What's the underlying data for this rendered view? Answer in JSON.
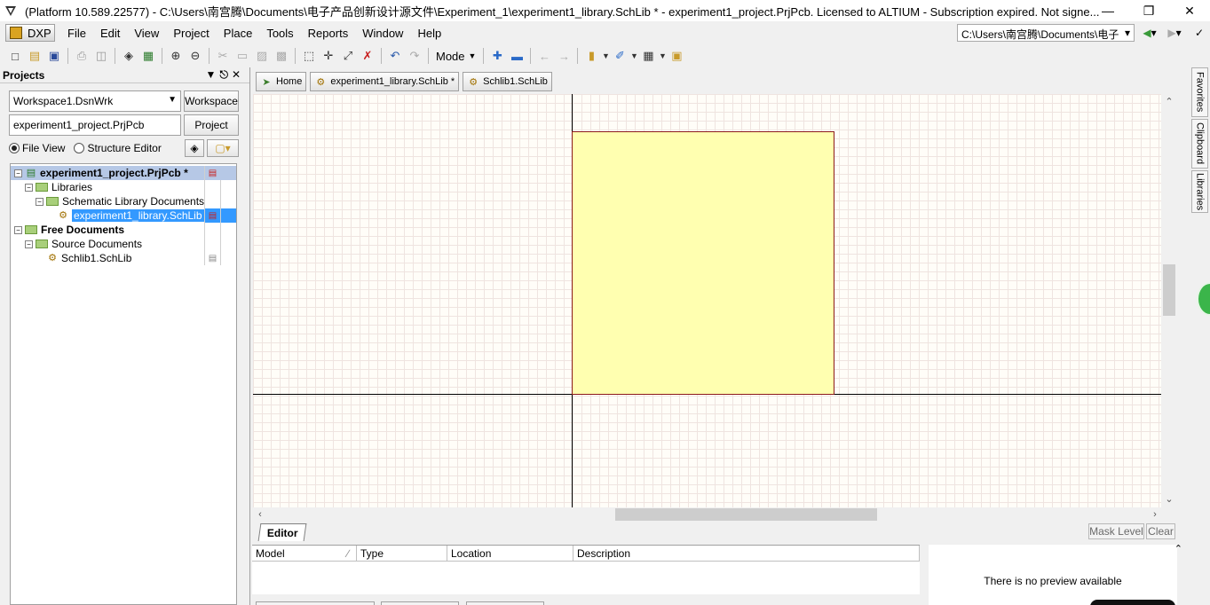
{
  "window": {
    "title": "(Platform 10.589.22577) - C:\\Users\\南宫腾\\Documents\\电子产品创新设计源文件\\Experiment_1\\experiment1_library.SchLib * - experiment1_project.PrjPcb. Licensed to ALTIUM - Subscription expired. Not signe...",
    "minimize_icon": "minimize-icon",
    "restore_icon": "restore-icon",
    "close_icon": "close-icon"
  },
  "menubar": {
    "dxp_label": "DXP",
    "items": [
      "File",
      "Edit",
      "View",
      "Project",
      "Place",
      "Tools",
      "Reports",
      "Window",
      "Help"
    ],
    "path": "C:\\Users\\南宫腾\\Documents\\电子"
  },
  "toolbar": {
    "mode_label": "Mode"
  },
  "projects_panel": {
    "title": "Projects",
    "workspace_value": "Workspace1.DsnWrk",
    "workspace_button": "Workspace",
    "project_value": "experiment1_project.PrjPcb",
    "project_button": "Project",
    "file_view_label": "File View",
    "structure_editor_label": "Structure Editor",
    "tree": [
      {
        "label": "experiment1_project.PrjPcb *",
        "level": 0,
        "type": "project",
        "bold": true
      },
      {
        "label": "Libraries",
        "level": 1,
        "type": "folder"
      },
      {
        "label": "Schematic Library Documents",
        "level": 2,
        "type": "folder"
      },
      {
        "label": "experiment1_library.SchLib *",
        "level": 3,
        "type": "schlib",
        "selected": true
      },
      {
        "label": "Free Documents",
        "level": 0,
        "type": "folder",
        "bold": true
      },
      {
        "label": "Source Documents",
        "level": 1,
        "type": "folder"
      },
      {
        "label": "Schlib1.SchLib",
        "level": 2,
        "type": "schlib"
      }
    ]
  },
  "doc_tabs": [
    {
      "label": "Home",
      "icon": "home-icon"
    },
    {
      "label": "experiment1_library.SchLib *",
      "icon": "schlib-icon"
    },
    {
      "label": "Schlib1.SchLib",
      "icon": "schlib-icon"
    }
  ],
  "side_tabs": [
    "Favorites",
    "Clipboard",
    "Libraries"
  ],
  "editor_panel": {
    "tab_label": "Editor",
    "mask_level": "Mask Level",
    "clear": "Clear",
    "columns": [
      "Model",
      "Type",
      "Location",
      "Description"
    ],
    "preview_message": "There is no preview available"
  },
  "colors": {
    "component_fill": "#ffffb0",
    "component_border": "#8b1a1a",
    "selection": "#3399ff"
  }
}
